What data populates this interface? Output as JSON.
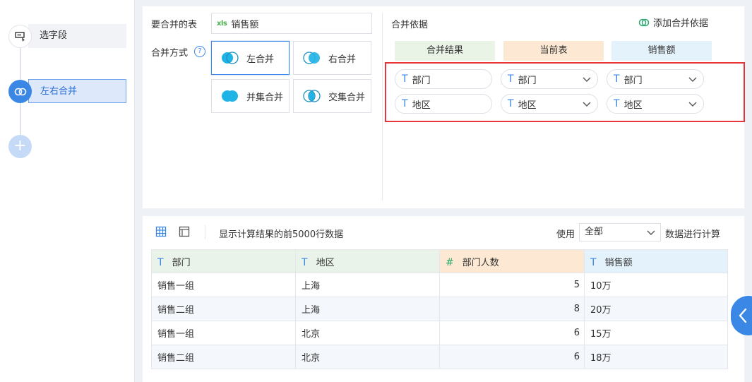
{
  "steps": [
    {
      "label": "选字段",
      "icon": "select-field-icon"
    },
    {
      "label": "左右合并",
      "icon": "merge-icon"
    }
  ],
  "add_step_glyph": "+",
  "config": {
    "table_label": "要合并的表",
    "table_icon_text": "xls",
    "table_name": "销售额",
    "mode_label": "合并方式",
    "help_glyph": "?",
    "modes": [
      "左合并",
      "右合并",
      "并集合并",
      "交集合并"
    ],
    "active_mode": "左合并",
    "basis_label": "合并依据",
    "add_basis_label": "添加合并依据",
    "columns": [
      "合并结果",
      "当前表",
      "销售额"
    ],
    "rows": [
      [
        "部门",
        "部门",
        "部门"
      ],
      [
        "地区",
        "地区",
        "地区"
      ]
    ],
    "field_type_glyph": "T"
  },
  "preview": {
    "note": "显示计算结果的前5000行数据",
    "use_label": "使用",
    "scope_value": "全部",
    "calc_label": "数据进行计算",
    "headers": [
      {
        "glyph": "T",
        "label": "部门"
      },
      {
        "glyph": "T",
        "label": "地区"
      },
      {
        "glyph": "#",
        "label": "部门人数"
      },
      {
        "glyph": "T",
        "label": "销售额"
      }
    ],
    "rows": [
      [
        "销售一组",
        "上海",
        "5",
        "10万"
      ],
      [
        "销售二组",
        "上海",
        "8",
        "20万"
      ],
      [
        "销售一组",
        "北京",
        "6",
        "15万"
      ],
      [
        "销售二组",
        "北京",
        "6",
        "18万"
      ]
    ]
  },
  "colors": {
    "accent": "#3a87e6",
    "highlight_border": "#e6363c"
  }
}
